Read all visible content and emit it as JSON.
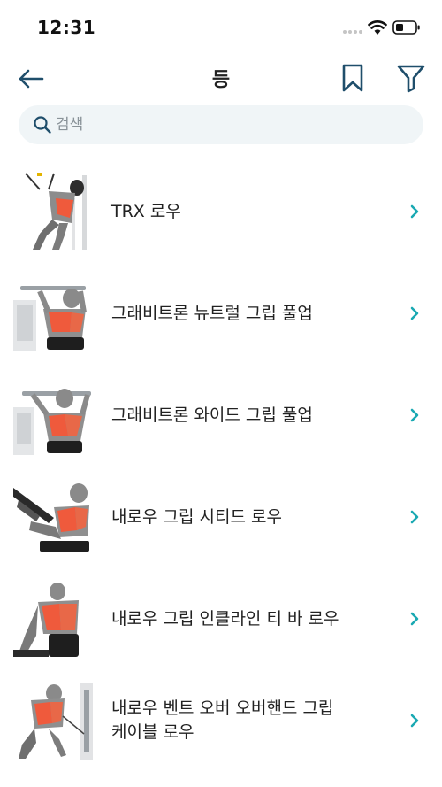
{
  "status_bar": {
    "time": "12:31"
  },
  "nav": {
    "title": "등",
    "back_icon": "arrow-left-icon",
    "bookmark_icon": "bookmark-icon",
    "filter_icon": "filter-icon"
  },
  "search": {
    "placeholder": "검색",
    "value": ""
  },
  "colors": {
    "accent": "#1aa9b2",
    "icon": "#1f4e6b",
    "muscle": "#ef5a3c"
  },
  "exercises": [
    {
      "name": "TRX 로우"
    },
    {
      "name": "그래비트론 뉴트럴 그립 풀업"
    },
    {
      "name": "그래비트론 와이드 그립 풀업"
    },
    {
      "name": "내로우 그립 시티드 로우"
    },
    {
      "name": "내로우 그립 인클라인 티 바 로우"
    },
    {
      "name": "내로우 벤트 오버 오버핸드 그립\n케이블 로우"
    }
  ]
}
